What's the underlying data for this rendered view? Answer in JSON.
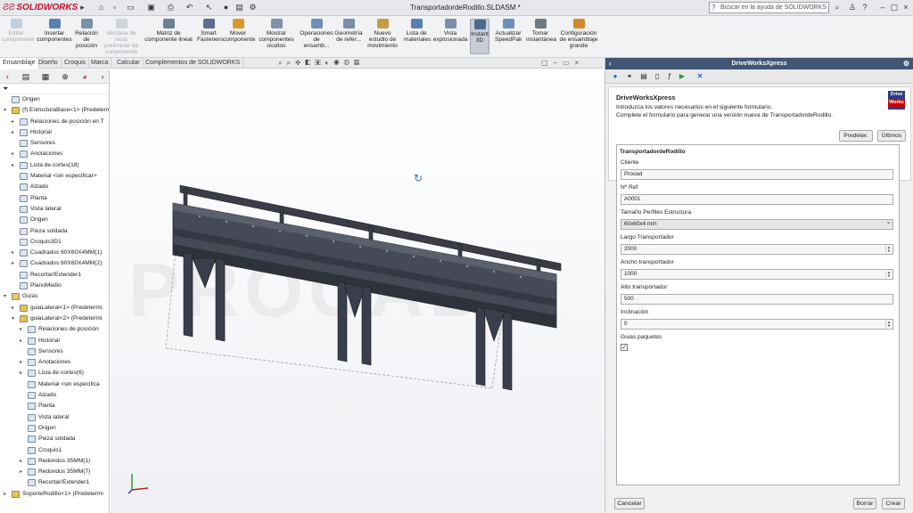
{
  "app": {
    "brand": "SOLIDWORKS",
    "doc_title": "TransportadordeRodillo.SLDASM *"
  },
  "search": {
    "placeholder": "Buscar en la ayuda de SOLIDWORKS"
  },
  "ribbon": [
    {
      "label": "Editar componente",
      "disabled": true,
      "color": "#6d8fb8"
    },
    {
      "label": "Insertar componentes",
      "color": "#5a7fb0"
    },
    {
      "label": "Relación de posición",
      "color": "#7a8fa8"
    },
    {
      "label": "Ventana de vista preliminar de componente",
      "disabled": true,
      "color": "#8b9bb0"
    },
    {
      "label": "Matriz de componente lineal",
      "color": "#6a7f98"
    },
    {
      "label": "Smart Fasteners",
      "color": "#5c7090"
    },
    {
      "label": "Mover componente",
      "color": "#d89a2a"
    },
    {
      "label": "Mostrar componentes ocultos",
      "color": "#8090a8"
    },
    {
      "label": "Operaciones de ensamb...",
      "color": "#6d8fb8"
    },
    {
      "label": "Geometría de refer...",
      "color": "#7a8fa8"
    },
    {
      "label": "Nuevo estudio de movimiento",
      "color": "#c0a040"
    },
    {
      "label": "Lista de materiales",
      "color": "#5a7fb0"
    },
    {
      "label": "Vista explosionada",
      "color": "#7a8fa8"
    },
    {
      "label": "Instant 3D",
      "active": true,
      "color": "#4a6a90"
    },
    {
      "label": "Actualizar SpeedPak",
      "color": "#6d8fb8"
    },
    {
      "label": "Tomar instantánea",
      "color": "#707880"
    },
    {
      "label": "Configuración de ensamblaje grande",
      "color": "#d08a30"
    }
  ],
  "tabs": [
    "Ensamblaje",
    "Diseño",
    "Croquis",
    "Marca",
    "Calcular",
    "Complementos de SOLIDWORKS"
  ],
  "tree": [
    {
      "level": 0,
      "label": "Origen",
      "icon": "origin-icon"
    },
    {
      "level": 0,
      "label": "(f) EstructuraBase<1> (Predeterm",
      "icon": "part-icon",
      "twisty": "▾"
    },
    {
      "level": 1,
      "label": "Relaciones de posición en T",
      "icon": "mates-icon",
      "twisty": "▸"
    },
    {
      "level": 1,
      "label": "Historial",
      "icon": "history-icon",
      "twisty": "▸"
    },
    {
      "level": 1,
      "label": "Sensores",
      "icon": "sensor-icon"
    },
    {
      "level": 1,
      "label": "Anotaciones",
      "icon": "annotation-icon",
      "twisty": "▸"
    },
    {
      "level": 1,
      "label": "Lista de cortes(18)",
      "icon": "cutlist-icon",
      "twisty": "▸"
    },
    {
      "level": 1,
      "label": "Material <sin especificar>",
      "icon": "material-icon"
    },
    {
      "level": 1,
      "label": "Alzado",
      "icon": "plane-icon"
    },
    {
      "level": 1,
      "label": "Planta",
      "icon": "plane-icon"
    },
    {
      "level": 1,
      "label": "Vista lateral",
      "icon": "plane-icon"
    },
    {
      "level": 1,
      "label": "Origen",
      "icon": "origin-icon"
    },
    {
      "level": 1,
      "label": "Pieza soldada",
      "icon": "weldment-icon"
    },
    {
      "level": 1,
      "label": "Croquis3D1",
      "icon": "sketch-icon"
    },
    {
      "level": 1,
      "label": "Cuadrados 60X60X4MM(1)",
      "icon": "structural-member-icon",
      "twisty": "▸"
    },
    {
      "level": 1,
      "label": "Cuadrados 60X60X4MM(2)",
      "icon": "structural-member-icon",
      "twisty": "▸"
    },
    {
      "level": 1,
      "label": "Recortar/Extender1",
      "icon": "trim-icon"
    },
    {
      "level": 1,
      "label": "PlanoMedio",
      "icon": "plane-icon"
    },
    {
      "level": 0,
      "label": "Guías",
      "icon": "folder-icon",
      "twisty": "▾"
    },
    {
      "level": 1,
      "label": "guiaLateral<1> (Predetermi",
      "icon": "part-icon",
      "twisty": "▸"
    },
    {
      "level": 1,
      "label": "guiaLateral<2> (Predetermi",
      "icon": "part-icon",
      "twisty": "▾"
    },
    {
      "level": 2,
      "label": "Relaciones de posición",
      "icon": "mates-icon",
      "twisty": "▸"
    },
    {
      "level": 2,
      "label": "Historial",
      "icon": "history-icon",
      "twisty": "▸"
    },
    {
      "level": 2,
      "label": "Sensores",
      "icon": "sensor-icon"
    },
    {
      "level": 2,
      "label": "Anotaciones",
      "icon": "annotation-icon",
      "twisty": "▸"
    },
    {
      "level": 2,
      "label": "Lista de cortes(6)",
      "icon": "cutlist-icon",
      "twisty": "▸"
    },
    {
      "level": 2,
      "label": "Material <sin especifica",
      "icon": "material-icon"
    },
    {
      "level": 2,
      "label": "Alzado",
      "icon": "plane-icon"
    },
    {
      "level": 2,
      "label": "Planta",
      "icon": "plane-icon"
    },
    {
      "level": 2,
      "label": "Vista lateral",
      "icon": "plane-icon"
    },
    {
      "level": 2,
      "label": "Origen",
      "icon": "origin-icon"
    },
    {
      "level": 2,
      "label": "Pieza soldada",
      "icon": "weldment-icon"
    },
    {
      "level": 2,
      "label": "Croquis1",
      "icon": "sketch-icon"
    },
    {
      "level": 2,
      "label": "Redondos 35MM(1)",
      "icon": "structural-member-icon",
      "twisty": "▸"
    },
    {
      "level": 2,
      "label": "Redondos 35MM(7)",
      "icon": "structural-member-icon",
      "twisty": "▸"
    },
    {
      "level": 2,
      "label": "Recortar/Extender1",
      "icon": "trim-icon"
    },
    {
      "level": 0,
      "label": "SoporteRodillo<1> (Predetermi",
      "icon": "part-icon",
      "twisty": "▸"
    }
  ],
  "viewport": {
    "watermark": "PROCAD"
  },
  "panel": {
    "title": "DriveWorksXpress",
    "info_title": "DriveWorksXpress",
    "info_line1": "Introduzca los valores necesarios en el siguiente formulario.",
    "info_line2": "Complete el formulario para generar una versión nueva de TransportadordeRodillo.",
    "logo_top": "Drive",
    "logo_bottom": "Works",
    "btn_default": "Predeter.",
    "btn_last": "Últimos",
    "form_title": "TransportadordeRodillo",
    "btn_cancel": "Cancelar",
    "btn_clear": "Borrar",
    "btn_create": "Crear",
    "fields": [
      {
        "label": "Cliente",
        "value": "Procad",
        "kind": "text"
      },
      {
        "label": "Nº Ref",
        "value": "A0001",
        "kind": "text"
      },
      {
        "label": "Tamaño Perfiles Estructura",
        "value": "60x60x4 mm",
        "kind": "select"
      },
      {
        "label": "Largo Transportador",
        "value": "2000",
        "kind": "spin"
      },
      {
        "label": "Ancho transportador",
        "value": "1000",
        "kind": "spin"
      },
      {
        "label": "Alto transportador",
        "value": "500",
        "kind": "text"
      },
      {
        "label": "Inclinación",
        "value": "0",
        "kind": "spin"
      }
    ],
    "checkbox_label": "Guias paquetes",
    "checkbox_checked": true
  }
}
